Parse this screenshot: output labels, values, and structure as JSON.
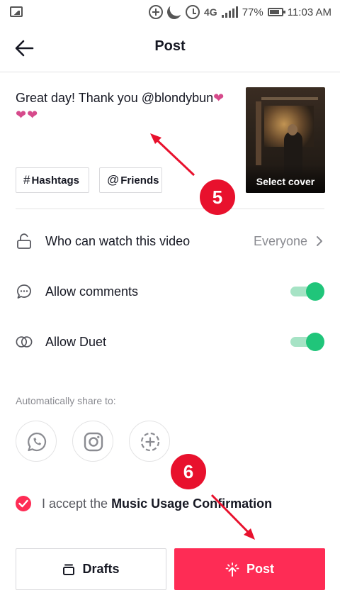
{
  "status_bar": {
    "network": "4G",
    "battery": "77%",
    "time": "11:03 AM"
  },
  "header": {
    "title": "Post"
  },
  "caption": {
    "text": "Great day! Thank you @blondybun",
    "hearts": "❤❤❤"
  },
  "chips": {
    "hashtags_symbol": "#",
    "hashtags_label": "Hashtags",
    "friends_symbol": "@",
    "friends_label": "Friends"
  },
  "cover": {
    "label": "Select cover"
  },
  "settings": {
    "who_can_watch": {
      "label": "Who can watch this video",
      "value": "Everyone"
    },
    "allow_comments": {
      "label": "Allow comments",
      "enabled": true
    },
    "allow_duet": {
      "label": "Allow Duet",
      "enabled": true
    }
  },
  "share": {
    "title": "Automatically share to:",
    "targets": [
      "whatsapp-icon",
      "instagram-icon",
      "add-more-icon"
    ]
  },
  "accept": {
    "prefix": "I accept the ",
    "link": "Music Usage Confirmation",
    "checked": true
  },
  "buttons": {
    "drafts": "Drafts",
    "post": "Post"
  },
  "annotations": {
    "step_5": "5",
    "step_6": "6"
  },
  "colors": {
    "accent": "#fe2c55",
    "toggle_on": "#20c57a",
    "annotation": "#e8112d",
    "heart": "#d64a8b"
  }
}
